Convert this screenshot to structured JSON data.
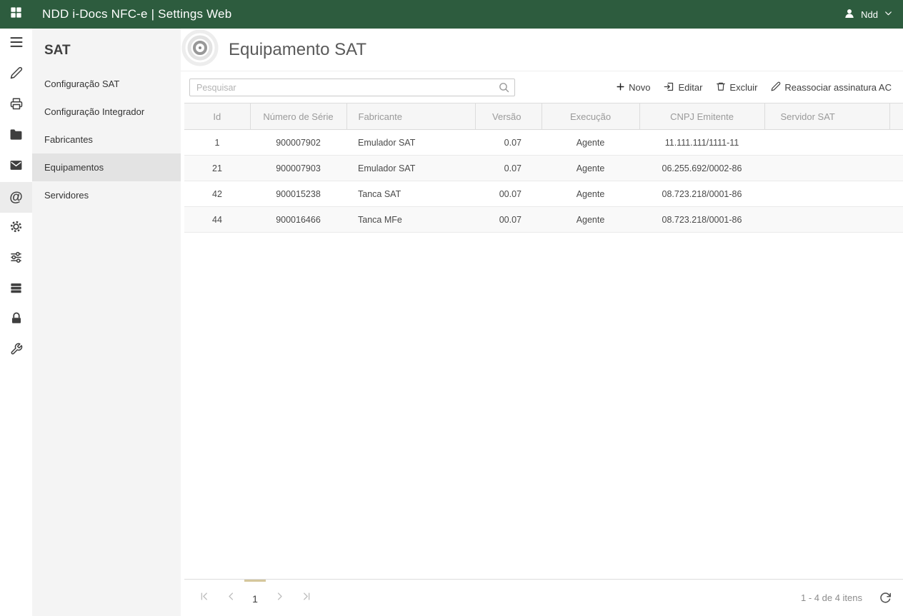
{
  "colors": {
    "topbar_bg": "#2d5c3e",
    "pager_accent": "#d5c79c",
    "selected_sidebar_bg": "#e3e3e3"
  },
  "topbar": {
    "title": "NDD i-Docs NFC-e | Settings Web",
    "user_name": "Ndd"
  },
  "iconbar": {
    "at_symbol": "@",
    "selected": "at"
  },
  "sidebar": {
    "title": "SAT",
    "items": [
      {
        "label": "Configuração SAT",
        "selected": false
      },
      {
        "label": "Configuração Integrador",
        "selected": false
      },
      {
        "label": "Fabricantes",
        "selected": false
      },
      {
        "label": "Equipamentos",
        "selected": true
      },
      {
        "label": "Servidores",
        "selected": false
      }
    ]
  },
  "main": {
    "title": "Equipamento SAT",
    "search": {
      "placeholder": "Pesquisar"
    },
    "toolbar": [
      {
        "label": "Novo",
        "icon": "plus-icon"
      },
      {
        "label": "Editar",
        "icon": "edit-icon"
      },
      {
        "label": "Excluir",
        "icon": "trash-icon"
      },
      {
        "label": "Reassociar assinatura AC",
        "icon": "pencil-icon"
      }
    ],
    "table": {
      "columns": [
        "Id",
        "Número de Série",
        "Fabricante",
        "Versão",
        "Execução",
        "CNPJ Emitente",
        "Servidor SAT"
      ],
      "rows": [
        [
          "1",
          "900007902",
          "Emulador SAT",
          "0.07",
          "Agente",
          "11.111.111/1111-11",
          ""
        ],
        [
          "21",
          "900007903",
          "Emulador SAT",
          "0.07",
          "Agente",
          "06.255.692/0002-86",
          ""
        ],
        [
          "42",
          "900015238",
          "Tanca SAT",
          "00.07",
          "Agente",
          "08.723.218/0001-86",
          ""
        ],
        [
          "44",
          "900016466",
          "Tanca MFe",
          "00.07",
          "Agente",
          "08.723.218/0001-86",
          ""
        ]
      ]
    },
    "pager": {
      "page": "1",
      "info": "1 - 4 de 4 itens"
    }
  }
}
